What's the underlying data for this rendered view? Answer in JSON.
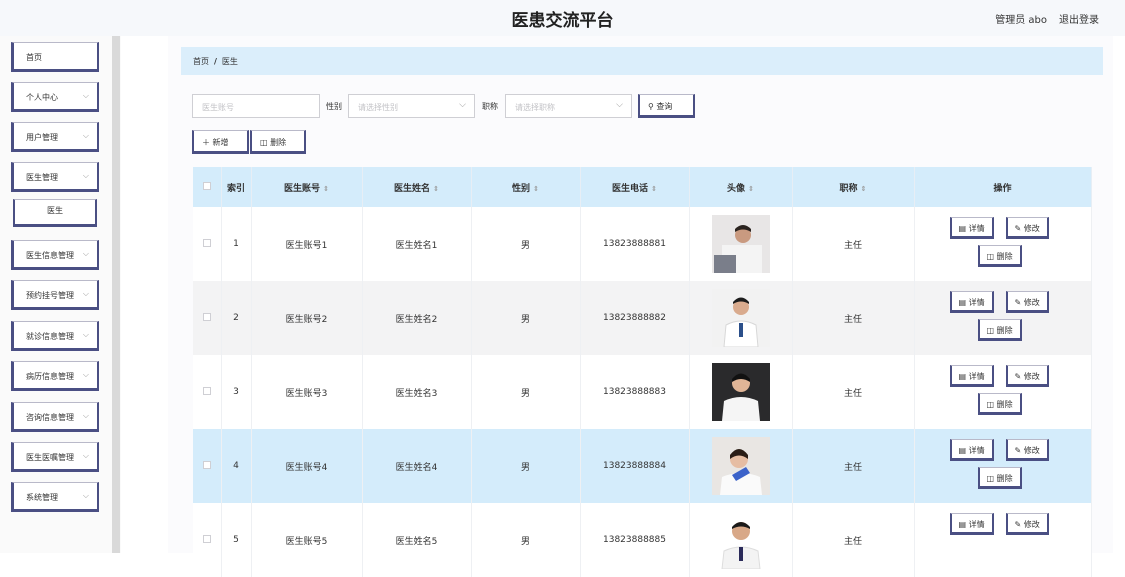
{
  "header": {
    "title": "医患交流平台",
    "user": "管理员 abo",
    "logout": "退出登录"
  },
  "sidebar": {
    "items": [
      {
        "label": "首页",
        "chevron": false
      },
      {
        "label": "个人中心",
        "chevron": true
      },
      {
        "label": "用户管理",
        "chevron": true
      },
      {
        "label": "医生管理",
        "chevron": true
      },
      {
        "label": "医生",
        "sub": true
      },
      {
        "label": "医生信息管理",
        "chevron": true
      },
      {
        "label": "预约挂号管理",
        "chevron": true
      },
      {
        "label": "就诊信息管理",
        "chevron": true
      },
      {
        "label": "病历信息管理",
        "chevron": true
      },
      {
        "label": "咨询信息管理",
        "chevron": true
      },
      {
        "label": "医生医嘱管理",
        "chevron": true
      },
      {
        "label": "系统管理",
        "chevron": true
      }
    ]
  },
  "breadcrumb": {
    "home": "首页",
    "sep": "/",
    "current": "医生"
  },
  "filters": {
    "account_placeholder": "医生账号",
    "gender_label": "性别",
    "gender_placeholder": "请选择性别",
    "title_label": "职称",
    "title_placeholder": "请选择职称",
    "search_label": "查询"
  },
  "toolbar": {
    "add_label": "新增",
    "delete_label": "删除"
  },
  "table": {
    "headers": [
      "",
      "索引",
      "医生账号",
      "医生姓名",
      "性别",
      "医生电话",
      "头像",
      "职称",
      "操作"
    ],
    "rows": [
      {
        "index": "1",
        "account": "医生账号1",
        "name": "医生姓名1",
        "gender": "男",
        "phone": "13823888881",
        "title": "主任"
      },
      {
        "index": "2",
        "account": "医生账号2",
        "name": "医生姓名2",
        "gender": "男",
        "phone": "13823888882",
        "title": "主任"
      },
      {
        "index": "3",
        "account": "医生账号3",
        "name": "医生姓名3",
        "gender": "男",
        "phone": "13823888883",
        "title": "主任"
      },
      {
        "index": "4",
        "account": "医生账号4",
        "name": "医生姓名4",
        "gender": "男",
        "phone": "13823888884",
        "title": "主任"
      },
      {
        "index": "5",
        "account": "医生账号5",
        "name": "医生姓名5",
        "gender": "男",
        "phone": "13823888885",
        "title": "主任"
      }
    ],
    "actions": {
      "detail": "详情",
      "edit": "修改",
      "delete": "删除"
    }
  },
  "colors": {
    "accent": "#4a4f83",
    "header_bg": "#d4ecfb",
    "breadcrumb_bg": "#dbeefb"
  }
}
